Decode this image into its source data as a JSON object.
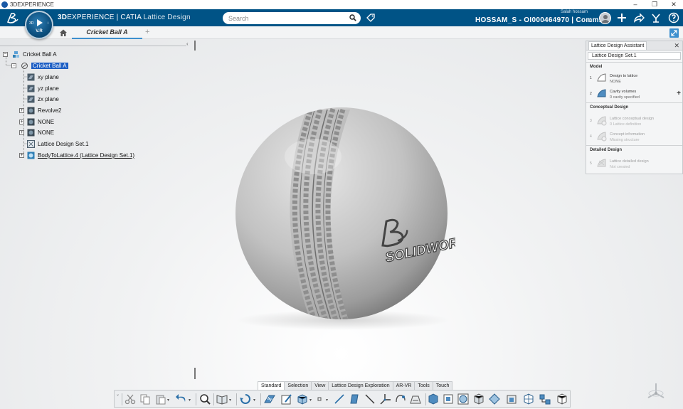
{
  "window": {
    "title": "3DEXPERIENCE",
    "controls": [
      "–",
      "❐",
      "✕"
    ]
  },
  "topbar": {
    "brand_3d": "3D",
    "brand_exp": "EXPERIENCE | CATIA",
    "brand_app": " Lattice Design",
    "search_placeholder": "Search",
    "user_small": "Salah hossam",
    "tenant": "HOSSAM_S - OI000464970 | Comm...",
    "tenant_caret": "⌄"
  },
  "compass": {
    "left": "3D",
    "right": "i",
    "bottom": "V.R"
  },
  "tabs": {
    "active": "Cricket Ball A",
    "add": "+"
  },
  "tree": {
    "collapse_arrow": "‹",
    "items": [
      {
        "label": "Cricket Ball A"
      },
      {
        "label": "Cricket Ball A"
      },
      {
        "label": "xy plane"
      },
      {
        "label": "yz plane"
      },
      {
        "label": "zx plane"
      },
      {
        "label": "Revolve2"
      },
      {
        "label": "NONE"
      },
      {
        "label": "NONE"
      },
      {
        "label": "Lattice Design Set.1"
      },
      {
        "label": "BodyToLattice.4 (Lattice Design Set.1)"
      }
    ]
  },
  "model": {
    "logo_text": "SOLIDWORKS"
  },
  "assistant": {
    "title": "Lattice Design Assistant",
    "set": "Lattice Design Set.1",
    "sections": {
      "model": "Model",
      "conceptual": "Conceptual Design",
      "detailed": "Detailed Design"
    },
    "steps": [
      {
        "num": "1",
        "title": "Design to lattice",
        "sub": "NONE"
      },
      {
        "num": "2",
        "title": "Cavity volumes",
        "sub": "0 cavity specified"
      },
      {
        "num": "3",
        "title": "Lattice conceptual design",
        "sub": "0 Lattice definition"
      },
      {
        "num": "4",
        "title": "Concept information",
        "sub": "Missing structure"
      },
      {
        "num": "5",
        "title": "Lattice detailed design",
        "sub": "Not created"
      }
    ]
  },
  "action_tabs": [
    "Standard",
    "Selection",
    "View",
    "Lattice Design Exploration",
    "AR-VR",
    "Tools",
    "Touch"
  ],
  "colors": {
    "topbar": "#005386",
    "accent": "#3d8fce",
    "selection": "#1d5fc4"
  }
}
